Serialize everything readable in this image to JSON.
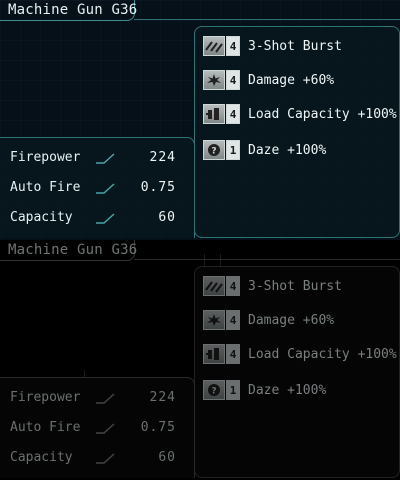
{
  "weapon_name": "Machine Gun G36",
  "abilities": [
    {
      "icon": "burst-icon",
      "level": "4",
      "label": "3-Shot Burst"
    },
    {
      "icon": "damage-icon",
      "level": "4",
      "label": "Damage +60%"
    },
    {
      "icon": "load-capacity-icon",
      "level": "4",
      "label": "Load Capacity +100%"
    },
    {
      "icon": "daze-icon",
      "level": "1",
      "label": "Daze +100%"
    }
  ],
  "stats": [
    {
      "label": "Firepower",
      "value": "224"
    },
    {
      "label": "Auto Fire",
      "value": "0.75"
    },
    {
      "label": "Capacity",
      "value": "60"
    }
  ],
  "colors": {
    "accent": "#3d8d91",
    "text": "#e6f2f2"
  }
}
